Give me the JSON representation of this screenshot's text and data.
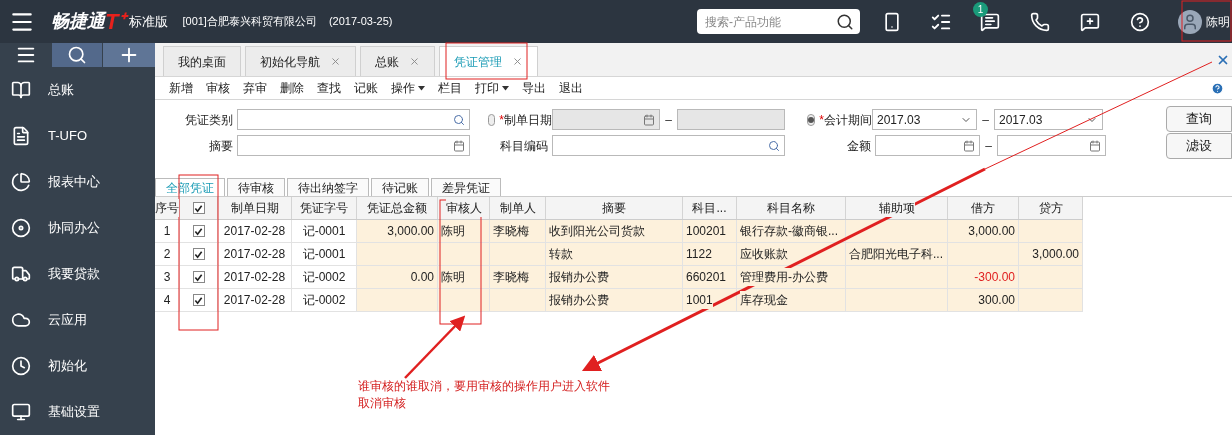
{
  "header": {
    "product": "畅捷通",
    "product_mark": "T⁺",
    "edition": "标准版",
    "company": "[001]合肥泰兴科贸有限公司",
    "date": "(2017-03-25)",
    "search_placeholder": "搜索-产品功能",
    "message_badge": "1",
    "user_name": "陈明"
  },
  "sidebar": {
    "items": [
      {
        "label": "总账"
      },
      {
        "label": "T-UFO"
      },
      {
        "label": "报表中心"
      },
      {
        "label": "协同办公"
      },
      {
        "label": "我要贷款"
      },
      {
        "label": "云应用"
      },
      {
        "label": "初始化"
      },
      {
        "label": "基础设置"
      }
    ]
  },
  "tabs": [
    {
      "label": "我的桌面",
      "closable": false,
      "selected": false
    },
    {
      "label": "初始化导航",
      "closable": true,
      "selected": false
    },
    {
      "label": "总账",
      "closable": true,
      "selected": false
    },
    {
      "label": "凭证管理",
      "closable": true,
      "selected": true
    }
  ],
  "toolbar": [
    {
      "label": "新增",
      "has_menu": false
    },
    {
      "label": "审核",
      "has_menu": false
    },
    {
      "label": "弃审",
      "has_menu": false
    },
    {
      "label": "删除",
      "has_menu": false
    },
    {
      "label": "查找",
      "has_menu": false
    },
    {
      "label": "记账",
      "has_menu": false
    },
    {
      "label": "操作",
      "has_menu": true
    },
    {
      "label": "栏目",
      "has_menu": false
    },
    {
      "label": "打印",
      "has_menu": true
    },
    {
      "label": "导出",
      "has_menu": false
    },
    {
      "label": "退出",
      "has_menu": false
    }
  ],
  "filters": {
    "voucher_type": {
      "label": "凭证类别"
    },
    "summary": {
      "label": "摘要"
    },
    "date": {
      "mark": "*",
      "label": "制单日期",
      "selected": false,
      "dash": "–"
    },
    "account_code": {
      "label": "科目编码"
    },
    "period": {
      "mark": "*",
      "label": "会计期间",
      "selected": true,
      "from": "2017.03",
      "to": "2017.03",
      "dash": "–"
    },
    "amount": {
      "label": "金额",
      "dash": "–"
    },
    "buttons": [
      "查询",
      "滤设"
    ]
  },
  "subtabs": [
    {
      "label": "全部凭证",
      "selected": true
    },
    {
      "label": "待审核",
      "selected": false
    },
    {
      "label": "待出纳签字",
      "selected": false
    },
    {
      "label": "待记账",
      "selected": false
    },
    {
      "label": "差异凭证",
      "selected": false
    }
  ],
  "table": {
    "columns": [
      "序号",
      "制单日期",
      "凭证字号",
      "凭证总金额",
      "审核人",
      "制单人",
      "摘要",
      "科目...",
      "科目名称",
      "辅助项",
      "借方",
      "贷方"
    ],
    "header_checked": true,
    "rows": [
      {
        "no": "1",
        "checked": true,
        "date": "2017-02-28",
        "voucher": "记-0001",
        "total": "3,000.00",
        "auditor": "陈明",
        "maker": "李晓梅",
        "summary": "收到阳光公司货款",
        "code": "100201",
        "account": "银行存款-徽商银...",
        "aux": "",
        "debit": "3,000.00",
        "debit_negative": false,
        "credit": ""
      },
      {
        "no": "2",
        "checked": true,
        "date": "2017-02-28",
        "voucher": "记-0001",
        "total": "",
        "auditor": "",
        "maker": "",
        "summary": "转款",
        "code": "1122",
        "account": "应收账款",
        "aux": "合肥阳光电子科...",
        "debit": "",
        "credit": "3,000.00"
      },
      {
        "no": "3",
        "checked": true,
        "date": "2017-02-28",
        "voucher": "记-0002",
        "total": "0.00",
        "auditor": "陈明",
        "maker": "李晓梅",
        "summary": "报销办公费",
        "code": "660201",
        "account": "管理费用-办公费",
        "aux": "",
        "debit": "-300.00",
        "debit_negative": true,
        "credit": ""
      },
      {
        "no": "4",
        "checked": true,
        "date": "2017-02-28",
        "voucher": "记-0002",
        "total": "",
        "auditor": "",
        "maker": "",
        "summary": "报销办公费",
        "code": "1001",
        "account": "库存现金",
        "aux": "",
        "debit": "300.00",
        "debit_negative": false,
        "credit": ""
      }
    ]
  },
  "annotation": {
    "lines": [
      "谁审核的谁取消，要用审核的操作用户进入软件",
      "取消审核"
    ]
  }
}
